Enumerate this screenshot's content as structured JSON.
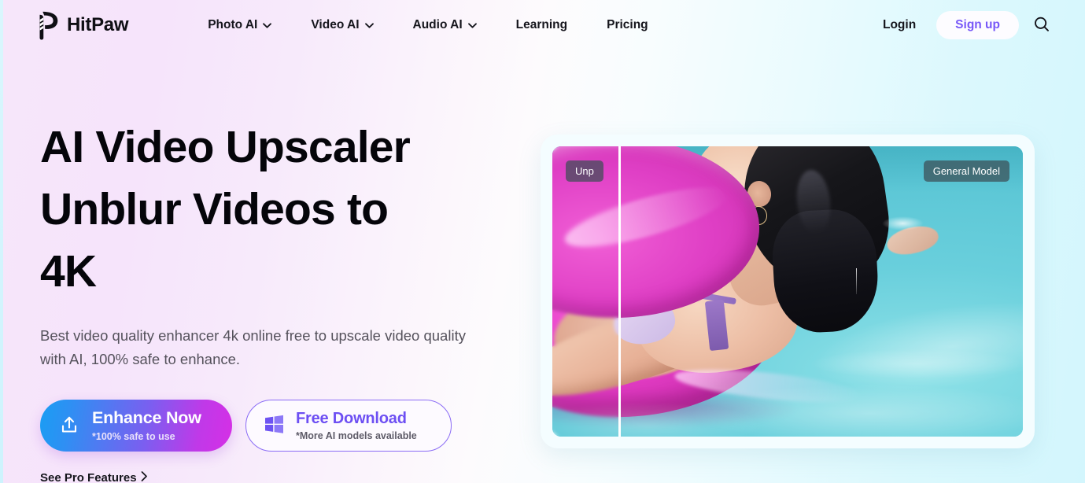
{
  "brand": {
    "name": "HitPaw",
    "logo_icon": "hitpaw-paw-p-logo"
  },
  "nav": {
    "items": [
      {
        "label": "Photo AI",
        "has_dropdown": true
      },
      {
        "label": "Video AI",
        "has_dropdown": true
      },
      {
        "label": "Audio AI",
        "has_dropdown": true
      },
      {
        "label": "Learning",
        "has_dropdown": false
      },
      {
        "label": "Pricing",
        "has_dropdown": false
      }
    ],
    "login_label": "Login",
    "signup_label": "Sign up",
    "search_icon": "search-icon"
  },
  "hero": {
    "title_line1": "AI Video Upscaler",
    "title_line2": "Unblur Videos to",
    "title_line3": "4K",
    "subtitle": "Best video quality enhancer 4k online free to upscale video quality with AI, 100% safe to enhance.",
    "primary_cta": {
      "label": "Enhance Now",
      "sublabel": "*100% safe to use",
      "icon": "upload-icon"
    },
    "secondary_cta": {
      "label": "Free Download",
      "sublabel": "*More AI models available",
      "icon": "windows-icon"
    },
    "pro_link": {
      "label": "See Pro Features",
      "icon": "chevron-right-icon"
    }
  },
  "preview": {
    "badge_left": "Unp",
    "badge_right": "General Model",
    "slider_position_percent": 14
  },
  "colors": {
    "accent_purple": "#7758f8",
    "cta_gradient_start": "#199ef3",
    "cta_gradient_end": "#d62fe6",
    "text_dark": "#05050a",
    "text_muted": "#55525c",
    "bg_left": "#f6e4fb",
    "bg_right": "#d3f6fd"
  }
}
